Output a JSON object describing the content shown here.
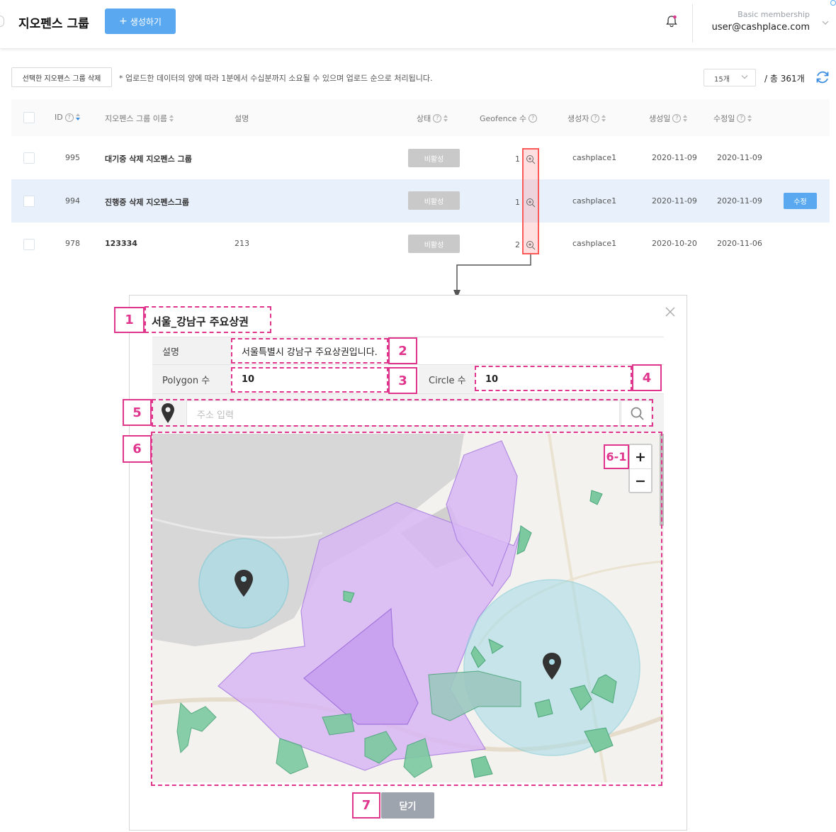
{
  "header": {
    "title": "지오펜스 그룹",
    "create_label": "생성하기",
    "membership": "Basic membership",
    "user": "user@cashplace.com"
  },
  "toolbar": {
    "delete_label": "선택한 지오펜스 그룹 삭제",
    "notice": "* 업로드한 데이터의 양에 따라 1분에서 수십분까지 소요될 수 있으며 업로드 순으로 처리됩니다.",
    "page_size": "15개",
    "total": "/ 총 361개"
  },
  "table": {
    "columns": [
      "ID",
      "지오펜스 그룹 이름",
      "설명",
      "상태",
      "Geofence 수",
      "생성자",
      "생성일",
      "수정일"
    ],
    "rows": [
      {
        "id": "995",
        "name": "대기중 삭제 지오펜스 그룹",
        "desc": "",
        "status": "비활성",
        "count": "1",
        "creator": "cashplace1",
        "created": "2020-11-09",
        "updated": "2020-11-09"
      },
      {
        "id": "994",
        "name": "진행중 삭제 지오펜스그룹",
        "desc": "",
        "status": "비활성",
        "count": "1",
        "creator": "cashplace1",
        "created": "2020-11-09",
        "updated": "2020-11-09"
      },
      {
        "id": "978",
        "name": "123334",
        "desc": "213",
        "status": "비활성",
        "count": "2",
        "creator": "cashplace1",
        "created": "2020-10-20",
        "updated": "2020-11-06"
      }
    ],
    "edit_label": "수정"
  },
  "modal": {
    "title": "서울_강남구 주요상권",
    "desc_label": "설명",
    "desc_value": "서울특별시 강남구 주요상권입니다.",
    "polygon_label": "Polygon 수",
    "polygon_value": "10",
    "circle_label": "Circle 수",
    "circle_value": "10",
    "search_placeholder": "주소 입력",
    "zoom_in": "+",
    "zoom_out": "−",
    "close_label": "닫기"
  },
  "annotations": [
    "1",
    "2",
    "3",
    "4",
    "5",
    "6",
    "6-1",
    "7"
  ],
  "colors": {
    "accent": "#5aa9f0",
    "annotation": "#e0358d",
    "highlight": "#ff5a5a",
    "polygon_fill": "#d9b8f5",
    "circle_fill": "#8fd4e0",
    "park_fill": "#7cc9a0"
  },
  "icons": [
    "bell-icon",
    "refresh-icon",
    "zoom-in-icon",
    "location-pin-icon",
    "search-icon",
    "close-icon",
    "map-marker-icon"
  ]
}
